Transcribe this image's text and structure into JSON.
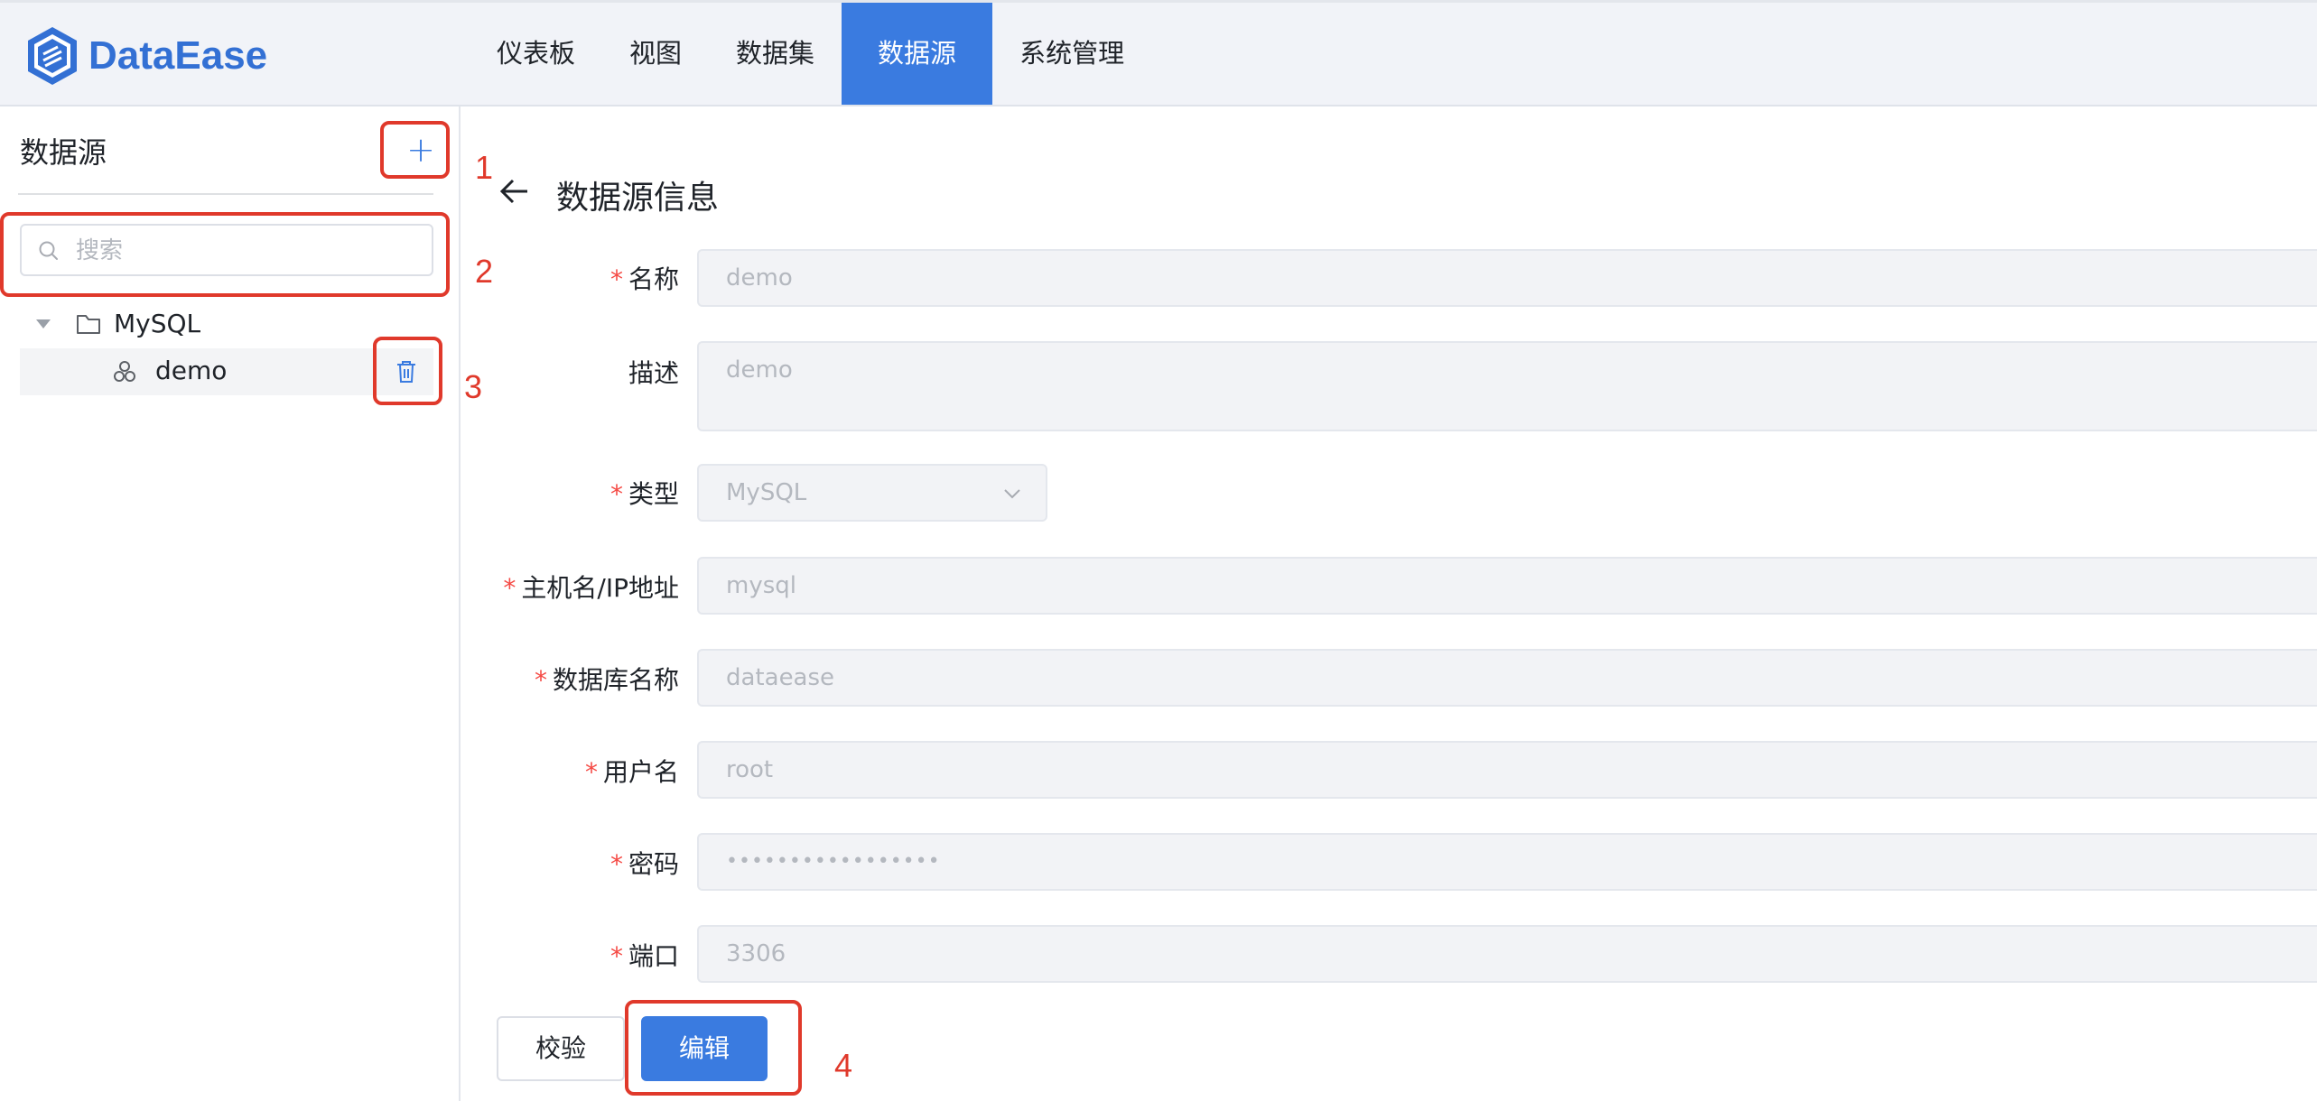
{
  "header": {
    "brand": "DataEase",
    "nav": [
      {
        "label": "仪表板"
      },
      {
        "label": "视图"
      },
      {
        "label": "数据集"
      },
      {
        "label": "数据源",
        "active": true
      },
      {
        "label": "系统管理"
      }
    ]
  },
  "sidebar": {
    "title": "数据源",
    "add_label": "+",
    "search_placeholder": "搜索",
    "tree": {
      "folder": "MySQL",
      "leaf": "demo"
    }
  },
  "main": {
    "title": "数据源信息",
    "fields": {
      "name": {
        "label": "名称",
        "value": "demo",
        "required": true
      },
      "desc": {
        "label": "描述",
        "value": "demo",
        "required": false
      },
      "type": {
        "label": "类型",
        "value": "MySQL",
        "required": true
      },
      "host": {
        "label": "主机名/IP地址",
        "value": "mysql",
        "required": true
      },
      "db": {
        "label": "数据库名称",
        "value": "dataease",
        "required": true
      },
      "user": {
        "label": "用户名",
        "value": "root",
        "required": true
      },
      "password": {
        "label": "密码",
        "value": "•••••••••••••••••",
        "required": true
      },
      "port": {
        "label": "端口",
        "value": "3306",
        "required": true
      }
    },
    "required_mark": "*",
    "verify_label": "校验",
    "edit_label": "编辑"
  },
  "annotations": [
    "1",
    "2",
    "3",
    "4"
  ],
  "colors": {
    "brand": "#3370d4",
    "accent": "#3a7be0",
    "annotation": "#e0392b",
    "required": "#f54a45"
  }
}
